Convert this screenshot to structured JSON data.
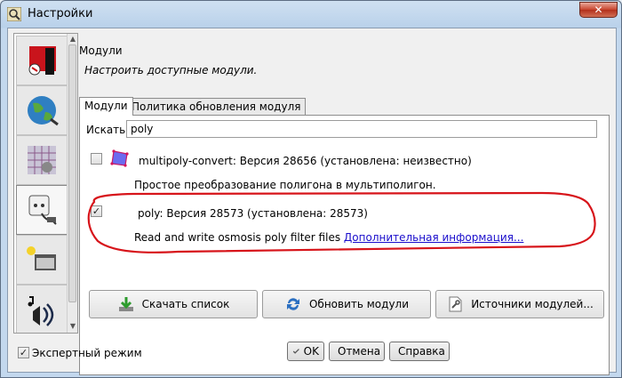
{
  "window": {
    "title": "Настройки",
    "close_label": "✕"
  },
  "section": {
    "title": "Модули",
    "description": "Настроить доступные модули."
  },
  "tabs": [
    {
      "label": "Модули",
      "active": true
    },
    {
      "label": "Политика обновления модуля",
      "active": false
    }
  ],
  "search": {
    "label": "Искать:",
    "value": "poly"
  },
  "plugins": [
    {
      "name": "multipoly-convert: Версия 28656 (установлена: неизвестно)",
      "description": "Простое преобразование полигона в мультиполигон.",
      "checked": false
    },
    {
      "name": "poly: Версия 28573 (установлена: 28573)",
      "description": "Read and write osmosis poly filter files",
      "link": "Дополнительная информация...",
      "checked": true
    }
  ],
  "toolbar": {
    "download": "Скачать список",
    "update": "Обновить модули",
    "sources": "Источники модулей..."
  },
  "expert_mode": {
    "label": "Экспертный режим",
    "checked": true
  },
  "buttons": {
    "ok": "OK",
    "cancel": "Отмена",
    "help": "Справка"
  },
  "colors": {
    "highlight": "#d7141a",
    "link": "#1a0dcc"
  }
}
